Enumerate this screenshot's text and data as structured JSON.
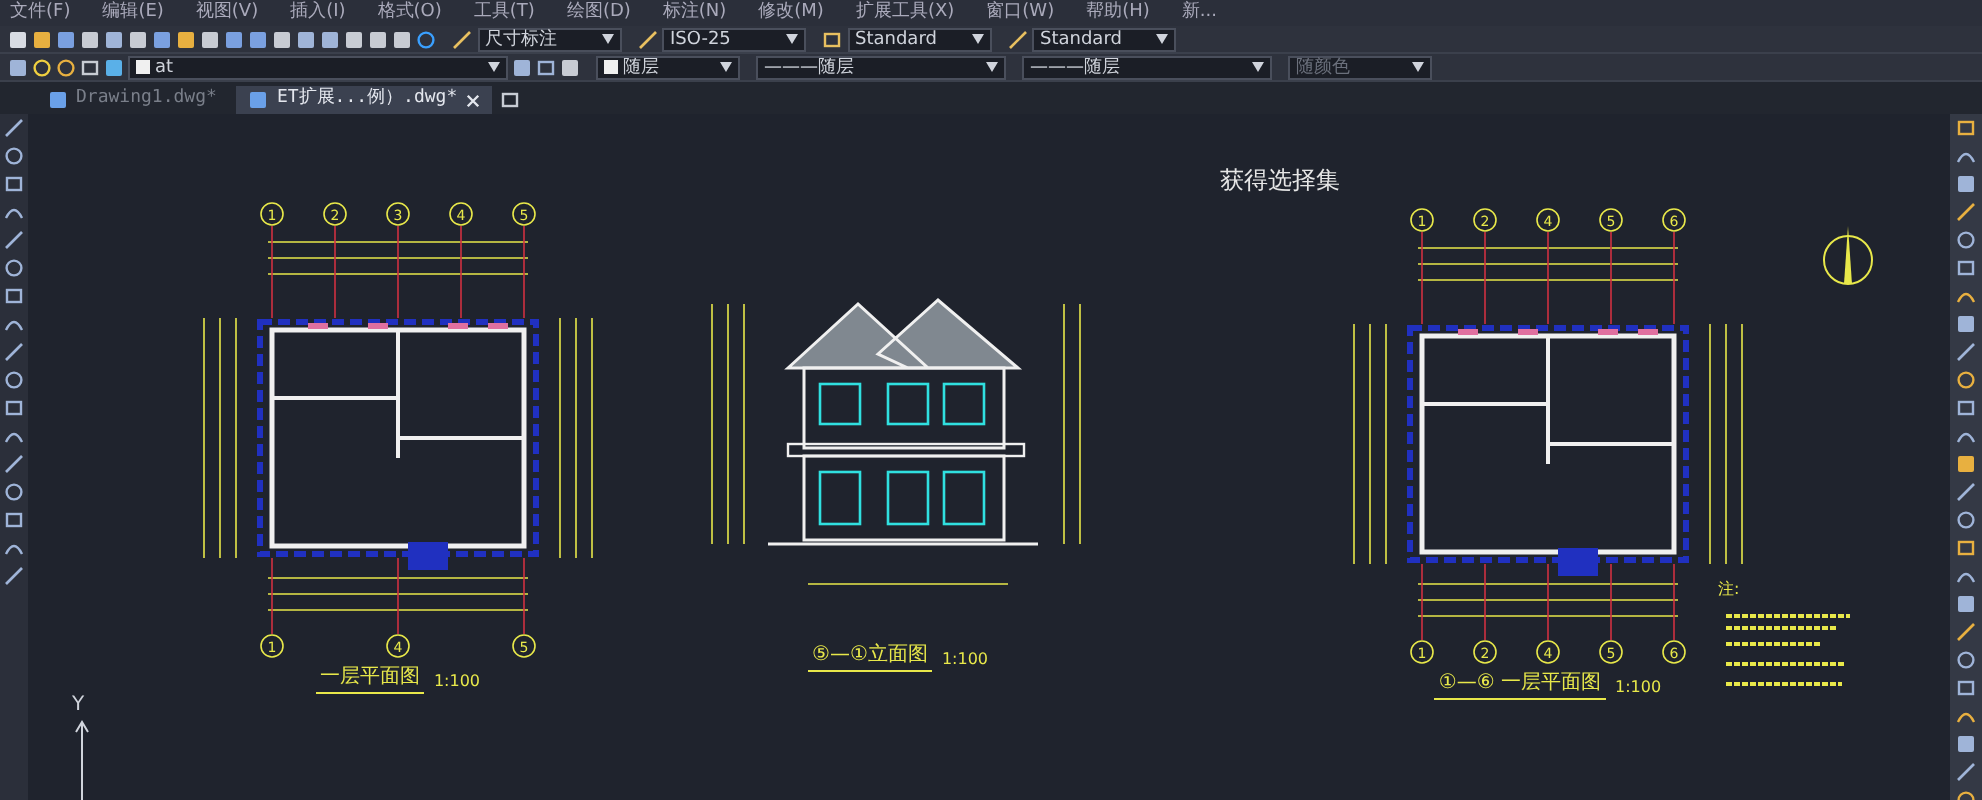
{
  "menu": [
    "文件(F)",
    "编辑(E)",
    "视图(V)",
    "插入(I)",
    "格式(O)",
    "工具(T)",
    "绘图(D)",
    "标注(N)",
    "修改(M)",
    "扩展工具(X)",
    "窗口(W)",
    "帮助(H)",
    "新..."
  ],
  "toolbar_1": {
    "combos": [
      {
        "text": "尺寸标注",
        "kind": "dim"
      },
      {
        "text": "ISO-25",
        "kind": "dim"
      },
      {
        "text": "Standard",
        "kind": "table"
      },
      {
        "text": "Standard",
        "kind": "multi"
      }
    ]
  },
  "toolbar_2": {
    "layer": "at",
    "combos": [
      {
        "text": "随层",
        "kind": "color",
        "disabled": false
      },
      {
        "text": "———随层",
        "kind": "line",
        "disabled": false
      },
      {
        "text": "———随层",
        "kind": "line",
        "disabled": false
      },
      {
        "text": "随颜色",
        "kind": "plot",
        "disabled": true
      }
    ]
  },
  "tabs": [
    {
      "label": "Drawing1.dwg*",
      "selected": false
    },
    {
      "label": "ET扩展...例）.dwg*",
      "selected": true
    }
  ],
  "canvas": {
    "heading": "获得选择集",
    "drawings": [
      {
        "kind": "plan",
        "title": "一层平面图",
        "scale": "1:100",
        "top_axes": [
          "1",
          "2",
          "3",
          "4",
          "5"
        ],
        "bottom_axes": [
          "1",
          "4",
          "5"
        ]
      },
      {
        "kind": "elevation",
        "title": "⑤—①立面图",
        "scale": "1:100"
      },
      {
        "kind": "plan",
        "title": "①—⑥ 一层平面图",
        "scale": "1:100",
        "top_axes": [
          "1",
          "2",
          "4",
          "5",
          "6"
        ],
        "bottom_axes": [
          "1",
          "2",
          "4",
          "5",
          "6"
        ]
      }
    ],
    "notes_heading": "注:",
    "axis_label": "Y"
  }
}
